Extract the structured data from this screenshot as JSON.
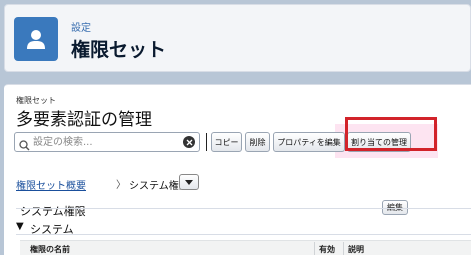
{
  "header": {
    "eyebrow": "設定",
    "title": "権限セット"
  },
  "record": {
    "eyebrow": "権限セット",
    "title": "多要素認証の管理"
  },
  "toolbar": {
    "search_placeholder": "設定の検索...",
    "buttons": {
      "copy": "コピー",
      "delete": "削除",
      "edit_properties": "プロパティを編集",
      "manage_assignments": "割り当ての管理"
    }
  },
  "breadcrumb": {
    "overview": "権限セット概要",
    "separator": "〉",
    "current": "システム権限"
  },
  "section": {
    "title": "システム権限",
    "edit": "編集",
    "subsection_toggle": "▼",
    "subsection": "システム"
  },
  "table": {
    "columns": [
      "権限の名前",
      "有効",
      "説明"
    ]
  },
  "colors": {
    "header_icon": "#3a79bd",
    "highlight": "#d2232a"
  }
}
